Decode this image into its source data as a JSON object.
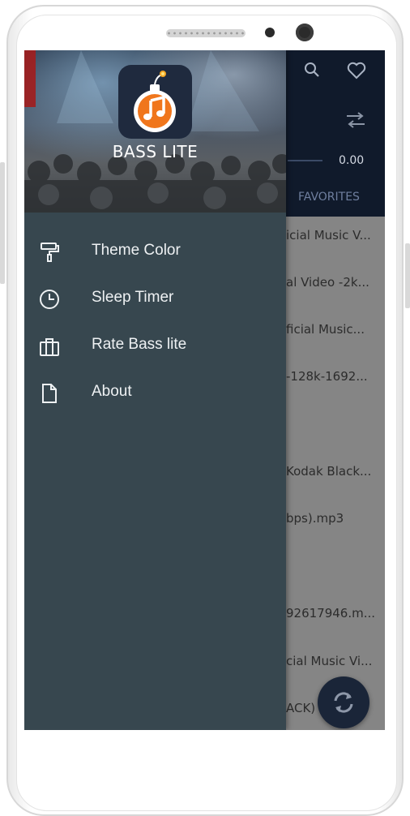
{
  "app": {
    "title": "BASS LITE",
    "time_display": "0.00",
    "visible_tab": "FAVORITES",
    "songs": [
      "icial Music V...",
      "al Video -2k...",
      "ficial Music...",
      "-128k-1692...",
      "Kodak Black...",
      "bps).mp3",
      "92617946.m...",
      "cial Music Vi...",
      "ACK) [..."
    ]
  },
  "drawer": {
    "items": [
      {
        "label": "Theme Color",
        "icon": "paint-roller-icon"
      },
      {
        "label": "Sleep Timer",
        "icon": "clock-icon"
      },
      {
        "label": "Rate Bass lite",
        "icon": "briefcase-icon"
      },
      {
        "label": "About",
        "icon": "document-icon"
      }
    ]
  },
  "colors": {
    "drawer_bg": "#37474f",
    "header_bg": "#101a2b",
    "accent_orange": "#f0761c",
    "list_overlay": "#858585"
  }
}
